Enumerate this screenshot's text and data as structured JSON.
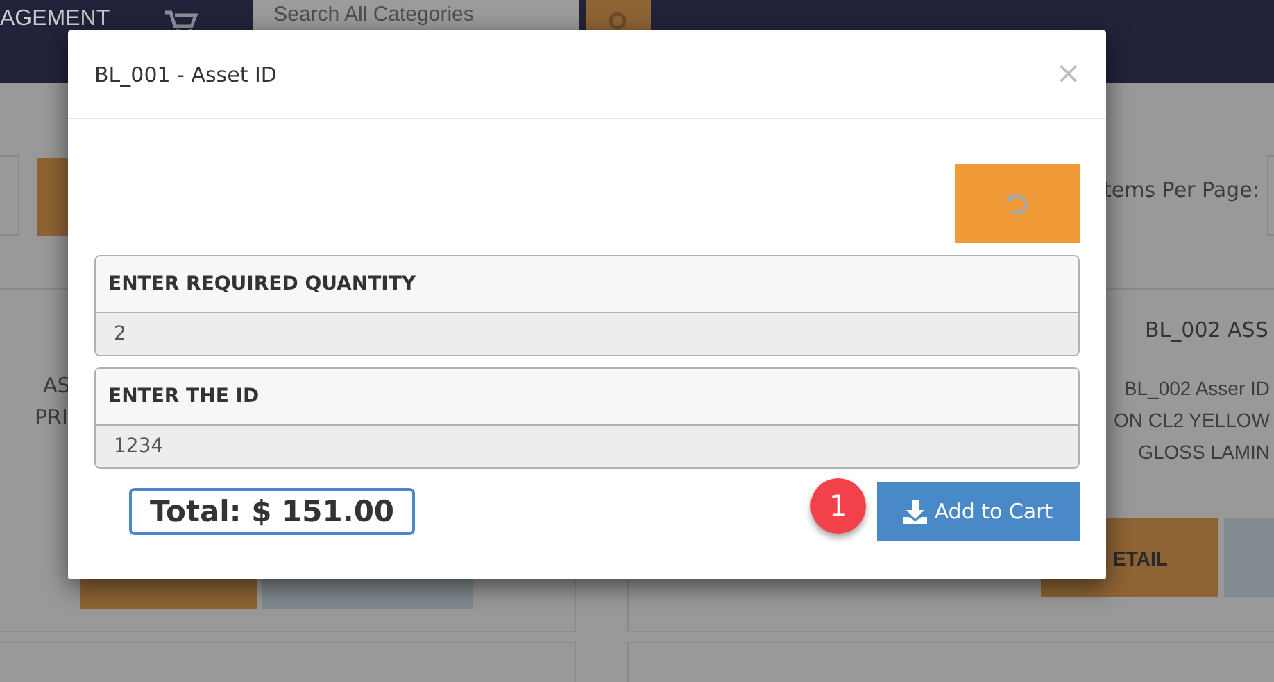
{
  "navbar": {
    "brand_fragment": "AGEMENT",
    "search": {
      "placeholder": "Search All Categories"
    }
  },
  "background": {
    "items_per_page_label": "tems Per Page:",
    "cards": [
      {
        "lines": [
          "AS",
          "PRI"
        ]
      },
      {
        "title": "BL_002 ASS",
        "lines": [
          "BL_002 Asser ID",
          "ON CL2 YELLOW",
          "GLOSS LAMIN"
        ],
        "button": "ETAIL"
      }
    ]
  },
  "modal": {
    "title": "BL_001 - Asset ID",
    "close": "×",
    "fields": [
      {
        "label": "ENTER REQUIRED QUANTITY",
        "value": "2"
      },
      {
        "label": "ENTER THE ID",
        "value": "1234"
      }
    ],
    "total": "Total: $ 151.00",
    "add_button": "Add to Cart",
    "badge": "1"
  }
}
